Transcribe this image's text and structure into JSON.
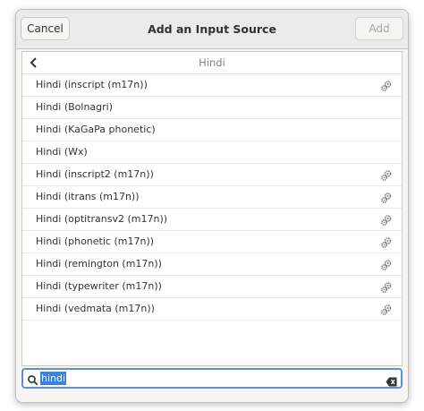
{
  "dialog": {
    "title": "Add an Input Source",
    "cancel_label": "Cancel",
    "add_label": "Add"
  },
  "list": {
    "header": "Hindi",
    "items": [
      {
        "label": "Hindi (inscript (m17n))",
        "has_settings": true
      },
      {
        "label": "Hindi (Bolnagri)",
        "has_settings": false
      },
      {
        "label": "Hindi (KaGaPa phonetic)",
        "has_settings": false
      },
      {
        "label": "Hindi (Wx)",
        "has_settings": false
      },
      {
        "label": "Hindi (inscript2 (m17n))",
        "has_settings": true
      },
      {
        "label": "Hindi (itrans (m17n))",
        "has_settings": true
      },
      {
        "label": "Hindi (optitransv2 (m17n))",
        "has_settings": true
      },
      {
        "label": "Hindi (phonetic (m17n))",
        "has_settings": true
      },
      {
        "label": "Hindi (remington (m17n))",
        "has_settings": true
      },
      {
        "label": "Hindi (typewriter (m17n))",
        "has_settings": true
      },
      {
        "label": "Hindi (vedmata (m17n))",
        "has_settings": true
      }
    ]
  },
  "search": {
    "value": "hindi"
  },
  "icons": {
    "back": "chevron-left-icon",
    "settings": "gears-icon",
    "search": "search-icon",
    "clear": "clear-text-icon"
  },
  "colors": {
    "accent": "#3584e4",
    "focus_border": "#5b92d3"
  }
}
